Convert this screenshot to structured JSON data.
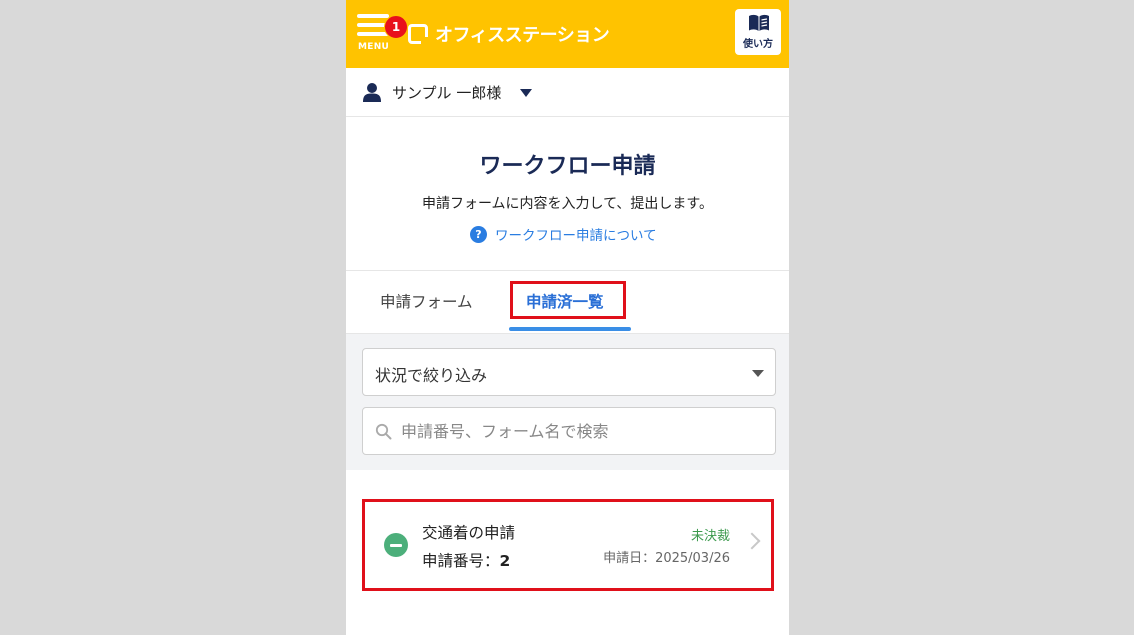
{
  "header": {
    "menu_label": "MENU",
    "notification_count": "1",
    "app_name": "オフィスステーション",
    "help_label": "使い方",
    "brand_color": "#ffc300"
  },
  "user": {
    "name": "サンプル 一郎様"
  },
  "intro": {
    "title": "ワークフロー申請",
    "description": "申請フォームに内容を入力して、提出します。",
    "help_link": "ワークフロー申請について"
  },
  "tabs": [
    {
      "label": "申請フォーム",
      "active": false
    },
    {
      "label": "申請済一覧",
      "active": true
    }
  ],
  "filters": {
    "status_selected": "状況で絞り込み",
    "search_placeholder": "申請番号、フォーム名で検索",
    "search_value": ""
  },
  "applications": [
    {
      "name": "交通着の申請",
      "number_label": "申請番号：",
      "number": "2",
      "status": "未決裁",
      "date": "申請日：2025/03/26"
    }
  ]
}
